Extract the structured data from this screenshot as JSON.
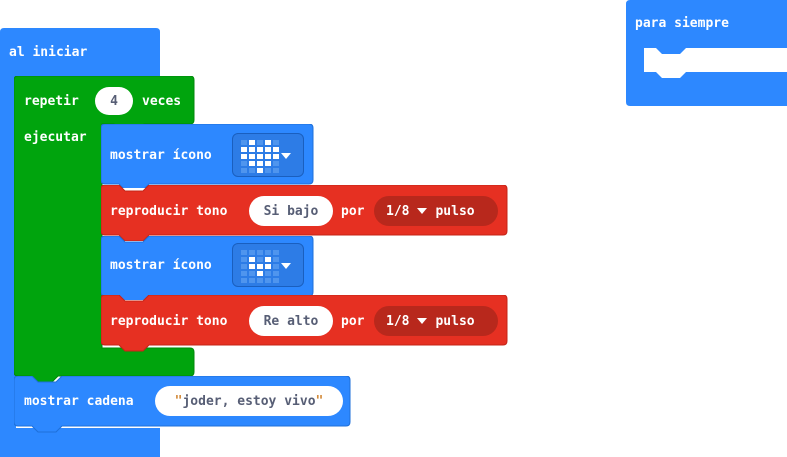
{
  "colors": {
    "basic_blue": "#2d88ff",
    "loops_green": "#00a40d",
    "music_red": "#e63022",
    "music_dark": "#b8281c"
  },
  "on_start": {
    "label": "al iniciar"
  },
  "forever": {
    "label": "para siempre"
  },
  "repeat": {
    "label": "repetir",
    "count": "4",
    "times_label": "veces",
    "do_label": "ejecutar"
  },
  "blocks": [
    {
      "label": "mostrar ícono",
      "icon": "big-heart-icon",
      "icon_pattern": [
        0,
        1,
        0,
        1,
        0,
        1,
        1,
        1,
        1,
        1,
        1,
        1,
        1,
        1,
        1,
        0,
        1,
        1,
        1,
        0,
        0,
        0,
        1,
        0,
        0
      ]
    },
    {
      "label": "reproducir tono",
      "note": "Si bajo",
      "beat_label": "por",
      "beat": "1/8",
      "beat_unit": "pulso"
    },
    {
      "label": "mostrar ícono",
      "icon": "small-heart-icon",
      "icon_pattern": [
        0,
        0,
        0,
        0,
        0,
        0,
        1,
        0,
        1,
        0,
        0,
        1,
        1,
        1,
        0,
        0,
        0,
        1,
        0,
        0,
        0,
        0,
        0,
        0,
        0
      ]
    },
    {
      "label": "reproducir tono",
      "note": "Re alto",
      "beat_label": "por",
      "beat": "1/8",
      "beat_unit": "pulso"
    }
  ],
  "show_string": {
    "label": "mostrar cadena",
    "open_quote": "\"",
    "value": "joder, estoy vivo",
    "close_quote": "\""
  }
}
